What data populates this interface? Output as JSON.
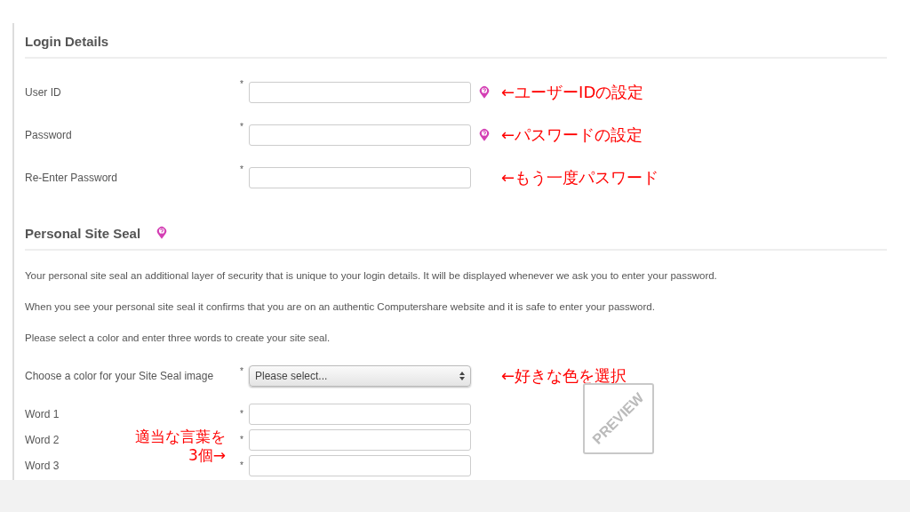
{
  "login_details": {
    "heading": "Login Details",
    "fields": [
      {
        "label": "User ID",
        "required_mark": "*",
        "help_icon": true,
        "annotation": "←ユーザーIDの設定"
      },
      {
        "label": "Password",
        "required_mark": "*",
        "help_icon": true,
        "annotation": "←パスワードの設定"
      },
      {
        "label": "Re-Enter Password",
        "required_mark": "*",
        "help_icon": false,
        "annotation": "←もう一度パスワード"
      }
    ]
  },
  "personal_site_seal": {
    "heading": "Personal Site Seal",
    "help_icon": true,
    "paragraphs": [
      "Your personal site seal an additional layer of security that is unique to your login details. It will be displayed whenever we ask you to enter your password.",
      "When you see your personal site seal it confirms that you are on an authentic Computershare website and it is safe to enter your password.",
      "Please select a color and enter three words to create your site seal."
    ],
    "color_select": {
      "label": "Choose a color for your Site Seal image",
      "required_mark": "*",
      "placeholder": "Please select...",
      "annotation": "←好きな色を選択"
    },
    "words": [
      {
        "label": "Word 1",
        "required_mark": "*"
      },
      {
        "label": "Word 2",
        "required_mark": "*"
      },
      {
        "label": "Word 3",
        "required_mark": "*"
      }
    ],
    "words_annotation": [
      "適当な言葉を",
      "3個→"
    ],
    "preview": "PREVIEW"
  }
}
